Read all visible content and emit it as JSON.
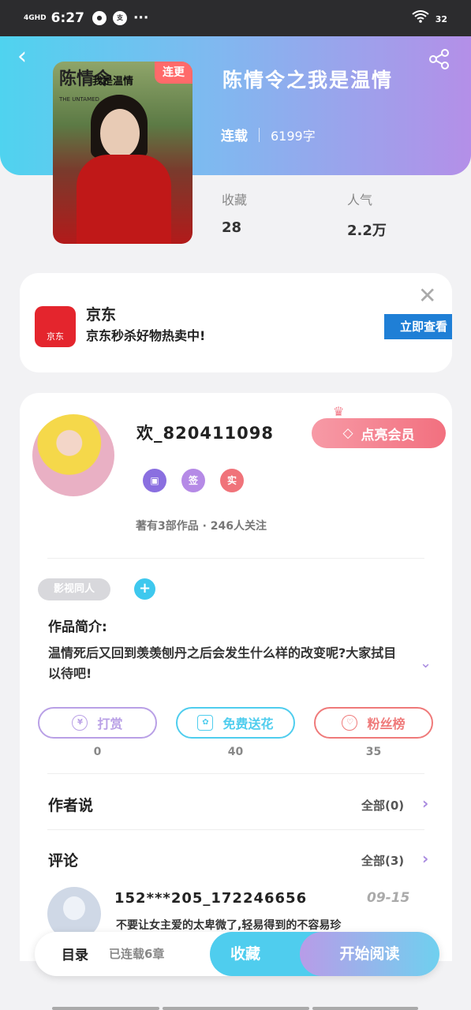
{
  "status": {
    "signal": "4GHD",
    "time": "6:27",
    "icons": [
      "jovi-icon",
      "alipay-icon",
      "more-dots"
    ],
    "battery": "32"
  },
  "book": {
    "title": "陈情令之我是温情",
    "status": "连载",
    "words": "6199字",
    "badge": "连更",
    "cover_title": "我是温情",
    "cover_logo": "陈情令",
    "cover_logo_sub": "THE UNTAMED"
  },
  "stats": [
    {
      "label": "收藏",
      "value": "28"
    },
    {
      "label": "人气",
      "value": "2.2万"
    }
  ],
  "ad": {
    "name": "京东",
    "desc": "京东秒杀好物热卖中!",
    "button": "立即查看",
    "logo_text": "京东"
  },
  "author": {
    "name": "欢_820411098",
    "vip_label": "点亮会员",
    "badges": [
      "签",
      "实"
    ],
    "stats": "著有3部作品 · 246人关注"
  },
  "tag": "影视同人",
  "intro": {
    "heading": "作品简介:",
    "text": "温情死后又回到羡羡刨丹之后会发生什么样的改变呢?大家拭目以待吧!"
  },
  "actions": [
    {
      "label": "打赏",
      "count": "0",
      "color": "#b9a0e6"
    },
    {
      "label": "免费送花",
      "count": "40",
      "color": "#4fcdee"
    },
    {
      "label": "粉丝榜",
      "count": "35",
      "color": "#ef7a7a"
    }
  ],
  "author_says": {
    "heading": "作者说",
    "all": "全部(0)"
  },
  "comments": {
    "heading": "评论",
    "all": "全部(3)",
    "first": {
      "user": "152***205_172246656",
      "date": "09-15",
      "text": "不要让女主爱的太卑微了,轻易得到的不容易珍"
    }
  },
  "bottom": {
    "toc": "目录",
    "chapters": "已连载6章",
    "fav": "收藏",
    "read": "开始阅读"
  }
}
